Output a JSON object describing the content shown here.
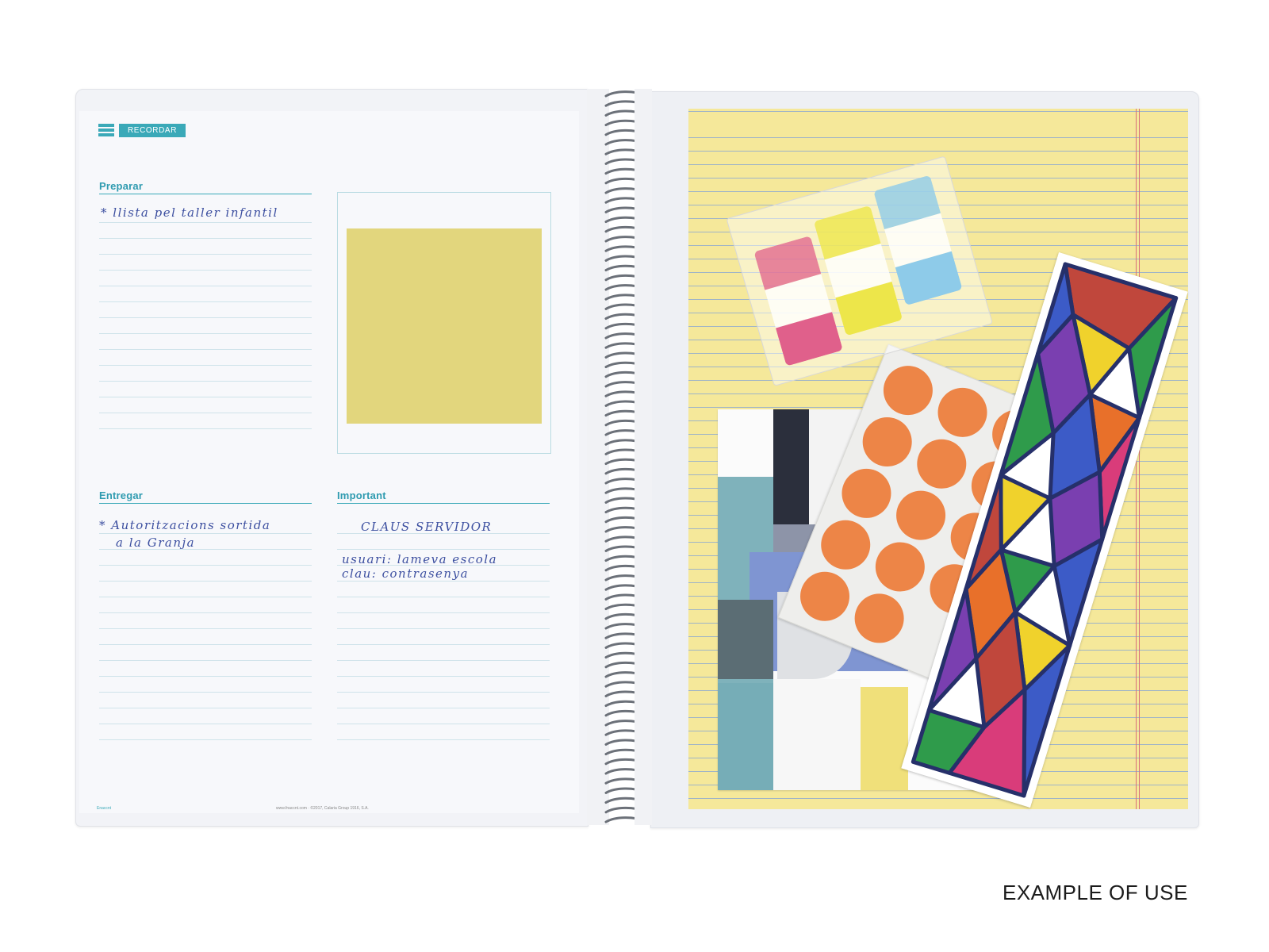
{
  "left_page": {
    "badge": "RECORDAR",
    "sections": {
      "preparar": {
        "label": "Preparar",
        "lines": [
          "* llista pel taller infantil"
        ]
      },
      "entregar": {
        "label": "Entregar",
        "lines": [
          "* Autoritzacions sortida",
          "a la Granja"
        ]
      },
      "important": {
        "label": "Important",
        "lines": [
          "CLAUS SERVIDOR",
          "usuari: lameva escola",
          "clau: contrasenya"
        ]
      }
    },
    "footer_brand": "Enaccnt",
    "footer_copyright": "www.fnaccnt.com · ©2017, Calaria Group 1916, S.A."
  },
  "colors": {
    "accent": "#3aa9b8",
    "handwriting": "#3c4fa0",
    "legal_pad": "#f5e89a",
    "sticky_note": "#e2d67d",
    "sticker_dots": "#ed8547",
    "flag_pink": "#e0608b",
    "flag_yellow": "#ede64a",
    "flag_blue": "#8ecbe9"
  },
  "caption": "EXAMPLE OF USE"
}
